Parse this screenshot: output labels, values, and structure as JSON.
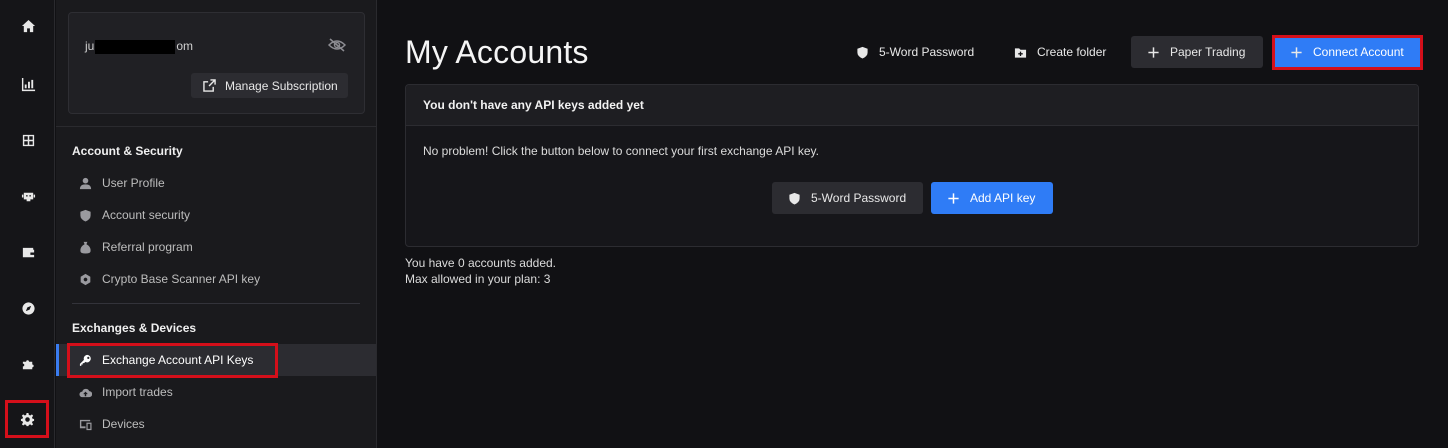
{
  "user": {
    "email_prefix": "ju",
    "email_suffix": "om",
    "manage_label": "Manage Subscription"
  },
  "sections": {
    "account_security": "Account & Security",
    "exchanges_devices": "Exchanges & Devices"
  },
  "menu": {
    "user_profile": "User Profile",
    "account_security": "Account security",
    "referral_program": "Referral program",
    "scanner_api_key": "Crypto Base Scanner API key",
    "exchange_api_keys": "Exchange Account API Keys",
    "import_trades": "Import trades",
    "devices": "Devices"
  },
  "main": {
    "title": "My Accounts",
    "btn_password": "5-Word Password",
    "btn_folder": "Create folder",
    "btn_paper": "Paper Trading",
    "btn_connect": "Connect Account",
    "card_header": "You don't have any API keys added yet",
    "card_text": "No problem! Click the button below to connect your first exchange API key.",
    "card_btn_password": "5-Word Password",
    "card_btn_add": "Add API key",
    "accounts_added": "You have 0 accounts added.",
    "max_allowed": "Max allowed in your plan: 3"
  },
  "colors": {
    "accent_blue": "#2f7cf6",
    "highlight_red": "#d40f1a",
    "background": "#111114"
  }
}
